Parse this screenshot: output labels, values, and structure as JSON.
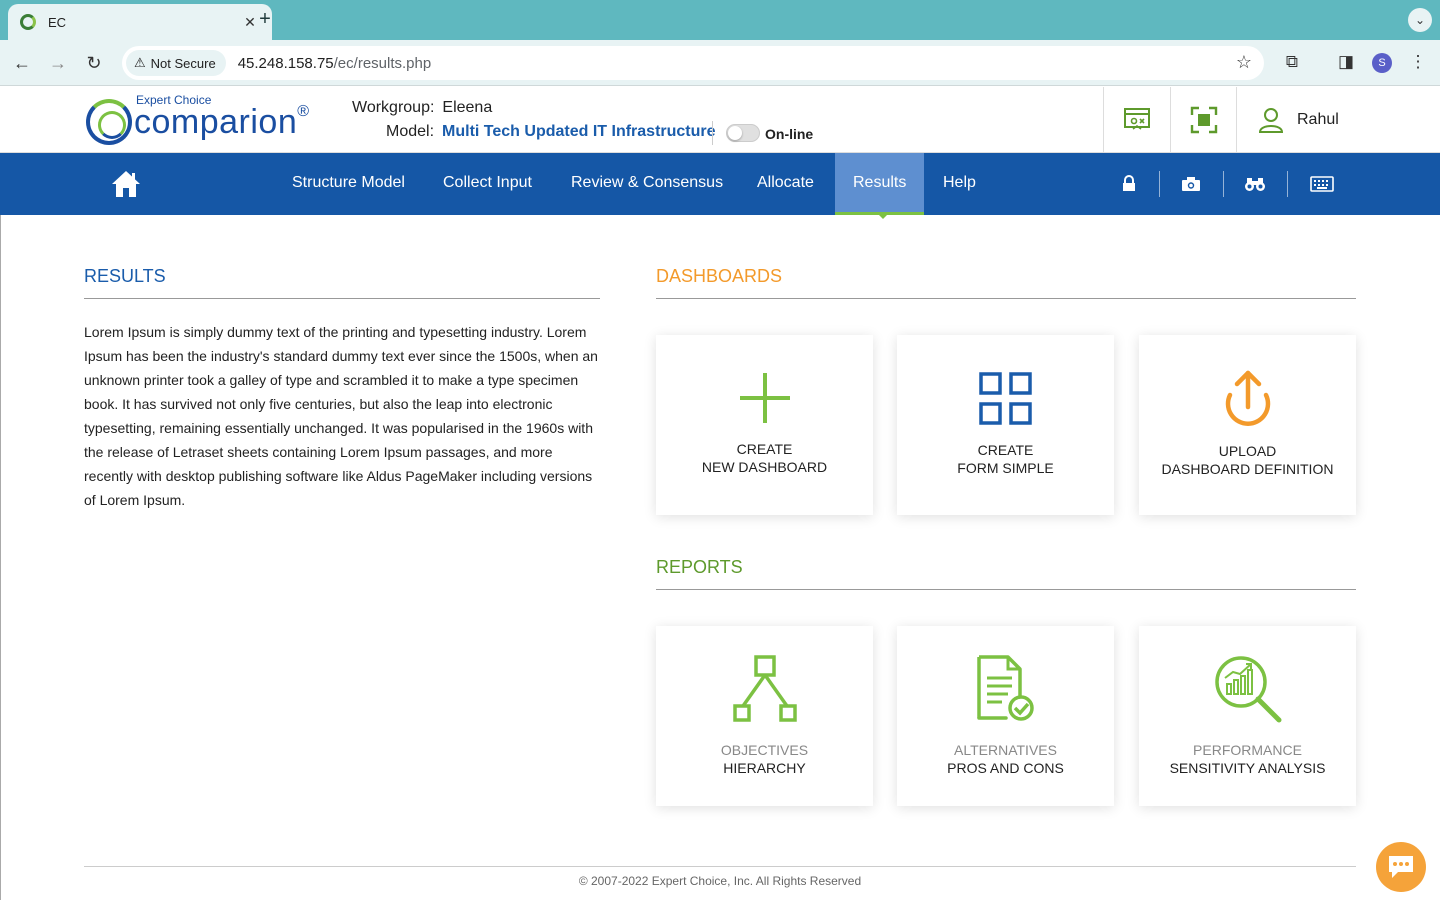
{
  "browser": {
    "tab_title": "EC",
    "security_label": "Not Secure",
    "url_host": "45.248.158.75",
    "url_path": "/ec/results.php",
    "profile_initial": "S"
  },
  "header": {
    "logo_top": "Expert Choice",
    "logo_main": "comparion",
    "logo_reg": "®",
    "workgroup_label": "Workgroup:",
    "workgroup_value": "Eleena",
    "model_label": "Model:",
    "model_value": "Multi Tech Updated IT Infrastructure",
    "online_label": "On-line",
    "online_state": "off",
    "user_name": "Rahul"
  },
  "nav": {
    "items": [
      {
        "label": "Structure Model"
      },
      {
        "label": "Collect Input"
      },
      {
        "label": "Review & Consensus"
      },
      {
        "label": "Allocate"
      },
      {
        "label": "Results"
      },
      {
        "label": "Help"
      }
    ],
    "active": "Results"
  },
  "results": {
    "title": "RESULTS",
    "body": "Lorem Ipsum is simply dummy text of the printing and typesetting industry. Lorem Ipsum has been the industry's standard dummy text ever since the 1500s, when an unknown printer took a galley of type and scrambled it to make a type specimen book. It has survived not only five centuries, but also the leap into electronic typesetting, remaining essentially unchanged. It was popularised in the 1960s with the release of Letraset sheets containing Lorem Ipsum passages, and more recently with desktop publishing software like Aldus PageMaker including versions of Lorem Ipsum."
  },
  "dashboards": {
    "title": "DASHBOARDS",
    "cards": [
      {
        "line1": "CREATE",
        "line2": "NEW DASHBOARD",
        "icon": "plus-icon"
      },
      {
        "line1": "CREATE",
        "line2": "FORM SIMPLE",
        "icon": "grid-icon"
      },
      {
        "line1": "UPLOAD",
        "line2": "DASHBOARD DEFINITION",
        "icon": "upload-icon"
      }
    ]
  },
  "reports": {
    "title": "REPORTS",
    "cards": [
      {
        "line1": "OBJECTIVES",
        "line2": "HIERARCHY",
        "icon": "hierarchy-icon"
      },
      {
        "line1": "ALTERNATIVES",
        "line2": "PROS AND CONS",
        "icon": "document-check-icon"
      },
      {
        "line1": "PERFORMANCE",
        "line2": "SENSITIVITY ANALYSIS",
        "icon": "chart-search-icon"
      }
    ]
  },
  "footer": {
    "copyright": "© 2007-2022 Expert Choice, Inc. All Rights Reserved"
  },
  "colors": {
    "nav_blue": "#1557a6",
    "active_tab": "#5e8fd0",
    "green": "#7cc142",
    "orange": "#f39a2b",
    "results_title": "#1a5cab",
    "dashboards_title": "#f39a2b",
    "reports_title": "#5e9a2c"
  }
}
